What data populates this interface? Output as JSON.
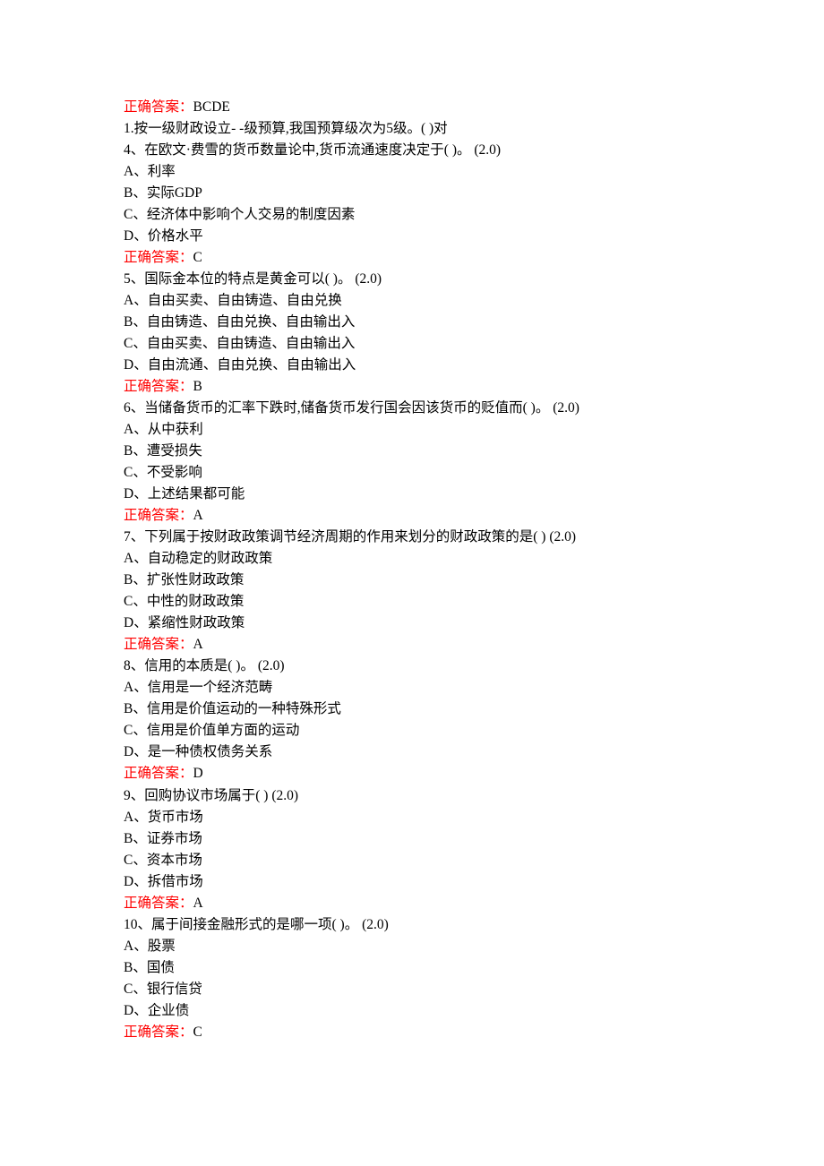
{
  "blocks": [
    {
      "type": "answer",
      "label": "正确答案：",
      "value": "BCDE"
    },
    {
      "type": "text",
      "text": "1.按一级财政设立- -级预算,我国预算级次为5级。( )对"
    },
    {
      "type": "text",
      "text": "4、在欧文·费雪的货币数量论中,货币流通速度决定于( )。 (2.0)"
    },
    {
      "type": "text",
      "text": "A、利率"
    },
    {
      "type": "text",
      "text": "B、实际GDP"
    },
    {
      "type": "text",
      "text": "C、经济体中影响个人交易的制度因素"
    },
    {
      "type": "text",
      "text": "D、价格水平"
    },
    {
      "type": "answer",
      "label": "正确答案：",
      "value": "C"
    },
    {
      "type": "text",
      "text": "5、国际金本位的特点是黄金可以( )。 (2.0)"
    },
    {
      "type": "text",
      "text": "A、自由买卖、自由铸造、自由兑换"
    },
    {
      "type": "text",
      "text": "B、自由铸造、自由兑换、自由输出入"
    },
    {
      "type": "text",
      "text": "C、自由买卖、自由铸造、自由输出入"
    },
    {
      "type": "text",
      "text": "D、自由流通、自由兑换、自由输出入"
    },
    {
      "type": "answer",
      "label": "正确答案：",
      "value": "B"
    },
    {
      "type": "text",
      "text": "6、当储备货币的汇率下跌时,储备货币发行国会因该货币的贬值而( )。 (2.0)"
    },
    {
      "type": "text",
      "text": "A、从中获利"
    },
    {
      "type": "text",
      "text": "B、遭受损失"
    },
    {
      "type": "text",
      "text": "C、不受影响"
    },
    {
      "type": "text",
      "text": "D、上述结果都可能"
    },
    {
      "type": "answer",
      "label": "正确答案：",
      "value": "A"
    },
    {
      "type": "text",
      "text": "7、下列属于按财政政策调节经济周期的作用来划分的财政政策的是( ) (2.0)"
    },
    {
      "type": "text",
      "text": "A、自动稳定的财政政策"
    },
    {
      "type": "text",
      "text": "B、扩张性财政政策"
    },
    {
      "type": "text",
      "text": "C、中性的财政政策"
    },
    {
      "type": "text",
      "text": "D、紧缩性财政政策"
    },
    {
      "type": "answer",
      "label": "正确答案：",
      "value": "A"
    },
    {
      "type": "text",
      "text": "8、信用的本质是( )。 (2.0)"
    },
    {
      "type": "text",
      "text": "A、信用是一个经济范畴"
    },
    {
      "type": "text",
      "text": "B、信用是价值运动的一种特殊形式"
    },
    {
      "type": "text",
      "text": "C、信用是价值单方面的运动"
    },
    {
      "type": "text",
      "text": "D、是一种债权债务关系"
    },
    {
      "type": "answer",
      "label": "正确答案：",
      "value": "D"
    },
    {
      "type": "text",
      "text": "9、回购协议市场属于( ) (2.0)"
    },
    {
      "type": "text",
      "text": "A、货币市场"
    },
    {
      "type": "text",
      "text": "B、证券市场"
    },
    {
      "type": "text",
      "text": "C、资本市场"
    },
    {
      "type": "text",
      "text": "D、拆借市场"
    },
    {
      "type": "answer",
      "label": "正确答案：",
      "value": "A"
    },
    {
      "type": "text",
      "text": "10、属于间接金融形式的是哪一项( )。 (2.0)"
    },
    {
      "type": "text",
      "text": "A、股票"
    },
    {
      "type": "text",
      "text": "B、国债"
    },
    {
      "type": "text",
      "text": "C、银行信贷"
    },
    {
      "type": "text",
      "text": "D、企业债"
    },
    {
      "type": "answer",
      "label": "正确答案：",
      "value": "C"
    }
  ]
}
